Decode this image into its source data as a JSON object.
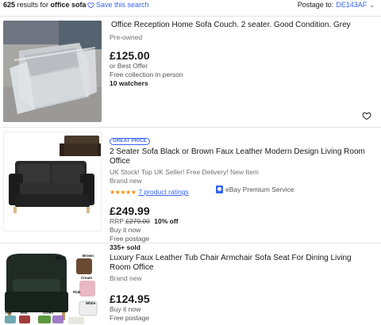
{
  "header": {
    "results_count": "625",
    "results_text": " results for ",
    "query": "office sofa",
    "save_label": "Save this search",
    "postage_label": "Postage to:",
    "postage_zip": "DE143AF"
  },
  "items": [
    {
      "title": "Office Reception Home Sofa Couch. 2 seater. Good Condition. Grey",
      "condition": "Pre-owned",
      "price": "£125.00",
      "buying_format": "or Best Offer",
      "delivery": "Free collection in person",
      "watchers": "10 watchers"
    },
    {
      "badge": "GREAT PRICE",
      "title": "2 Seater Sofa Black or Brown Faux Leather Modern Design Living Room Office",
      "subtitle": "UK Stock! Top UK Seller! Free Delivery! New Item",
      "condition": "Brand new",
      "stars": "★★★★★",
      "ratings": "7 product ratings",
      "price": "£249.99",
      "rrp_label": "RRP",
      "rrp_price": "£279.00",
      "discount": "10% off",
      "buying_format": "Buy it now",
      "delivery": "Free postage",
      "sold": "335+ sold",
      "premium": "eBay Premium Service"
    },
    {
      "title": "Luxury Faux Leather Tub Chair Armchair Sofa Seat For Dining Living Room Office",
      "condition": "Brand new",
      "price": "£124.95",
      "buying_format": "Buy it now",
      "delivery": "Free postage",
      "image_labels": {
        "black": "Black",
        "brown": "Brown",
        "cream": "Cream",
        "pink": "Pink",
        "white": "White",
        "teal": "Teal",
        "red": "Red",
        "green": "Green"
      }
    }
  ],
  "colors": {
    "link_blue": "#3665f3",
    "star_orange": "#f18e00",
    "text": "#191919",
    "muted": "#707070"
  },
  "icons": {
    "save": "heart-icon",
    "watch": "heart-outline-icon",
    "postage": "chevron-down-icon",
    "premium": "premium-service-icon"
  }
}
